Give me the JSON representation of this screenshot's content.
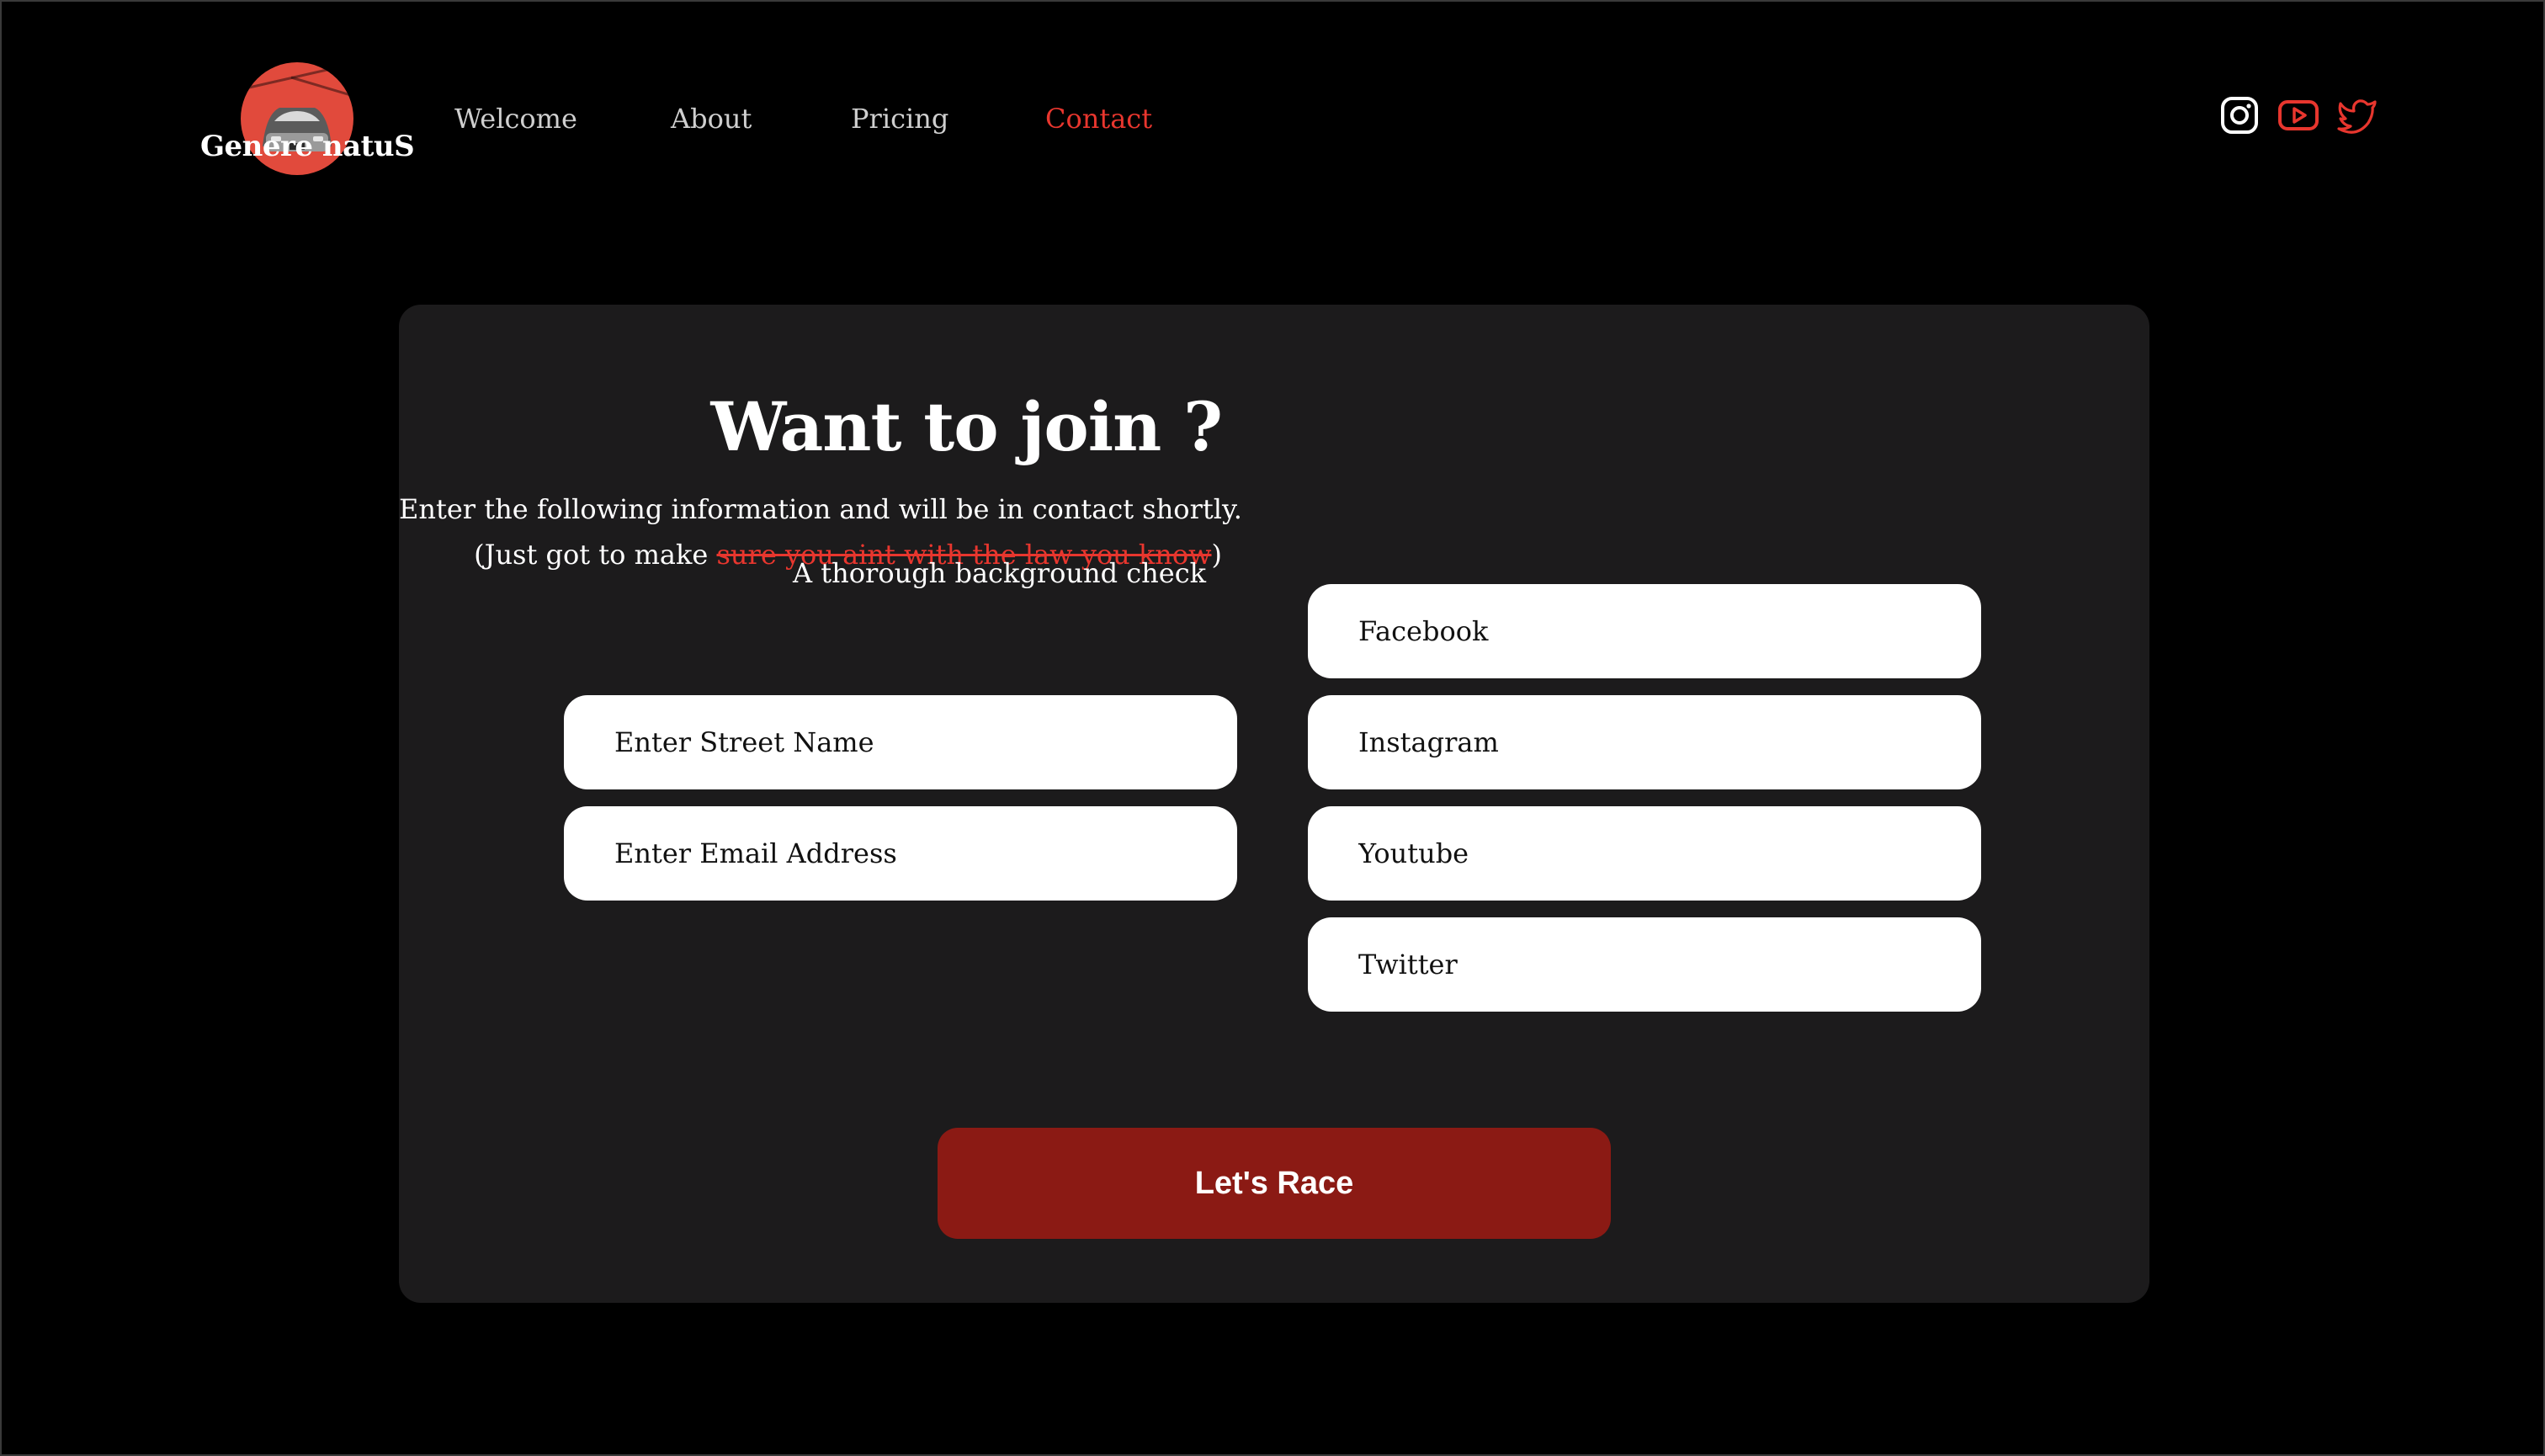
{
  "brand": {
    "name": "Genere natuS",
    "logo_color": "#e14a3c"
  },
  "nav": {
    "items": [
      {
        "label": "Welcome",
        "active": false
      },
      {
        "label": "About",
        "active": false
      },
      {
        "label": "Pricing",
        "active": false
      },
      {
        "label": "Contact",
        "active": true
      }
    ],
    "active_color": "#e8362e"
  },
  "social": [
    {
      "icon": "instagram-icon"
    },
    {
      "icon": "youtube-icon"
    },
    {
      "icon": "twitter-icon"
    }
  ],
  "form": {
    "title": "Want to join ?",
    "intro_line1": "Enter the following information and will be in contact shortly.",
    "intro_line2_prefix": "(Just got to make ",
    "intro_line2_struck": "sure you aint with the law you know",
    "intro_line2_suffix": ")",
    "overlay_note": "A thorough background check",
    "left_fields": [
      {
        "placeholder": "Enter Street Name",
        "value": ""
      },
      {
        "placeholder": "Enter Email Address",
        "value": ""
      }
    ],
    "right_fields": [
      {
        "placeholder": "Facebook",
        "value": ""
      },
      {
        "placeholder": "Instagram",
        "value": ""
      },
      {
        "placeholder": "Youtube",
        "value": ""
      },
      {
        "placeholder": "Twitter",
        "value": ""
      }
    ],
    "submit_label": "Let's Race",
    "submit_color": "#8b1a14"
  }
}
